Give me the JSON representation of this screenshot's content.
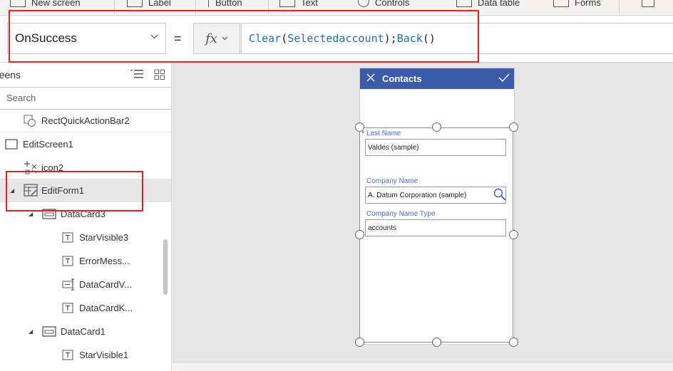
{
  "ribbon": {
    "items": [
      {
        "label": "New screen"
      },
      {
        "label": "Label"
      },
      {
        "label": "Button"
      },
      {
        "label": "Text"
      },
      {
        "label": "Controls"
      },
      {
        "label": "Data table"
      },
      {
        "label": "Forms"
      }
    ]
  },
  "formula_bar": {
    "property": "OnSuccess",
    "equals": "=",
    "fx": "fx",
    "formula": {
      "fn1": "Clear",
      "open1": "(",
      "arg1": "Selectedaccount",
      "close1": ");",
      "fn2": "Back",
      "call2": "()"
    }
  },
  "tree": {
    "title": "reens",
    "search_placeholder": "Search",
    "items": [
      {
        "label": "RectQuickActionBar2"
      },
      {
        "label": "EditScreen1"
      },
      {
        "label": "icon2"
      },
      {
        "label": "EditForm1"
      },
      {
        "label": "DataCard3"
      },
      {
        "label": "StarVisible3"
      },
      {
        "label": "ErrorMess..."
      },
      {
        "label": "DataCardV..."
      },
      {
        "label": "DataCardK..."
      },
      {
        "label": "DataCard1"
      },
      {
        "label": "StarVisible1"
      }
    ]
  },
  "app": {
    "header_title": "Contacts",
    "fields": [
      {
        "label": "Last Name",
        "required": "*",
        "value": "Valdes (sample)"
      },
      {
        "label": "Company Name",
        "value": "A. Datum Corporation (sample)"
      },
      {
        "label": "Company Name Type",
        "value": "accounts"
      }
    ]
  },
  "colors": {
    "header_blue": "#3c5ba8",
    "highlight_red": "#e32020",
    "formula_blue": "#1a73a8",
    "label_blue": "#4a6fb3"
  }
}
